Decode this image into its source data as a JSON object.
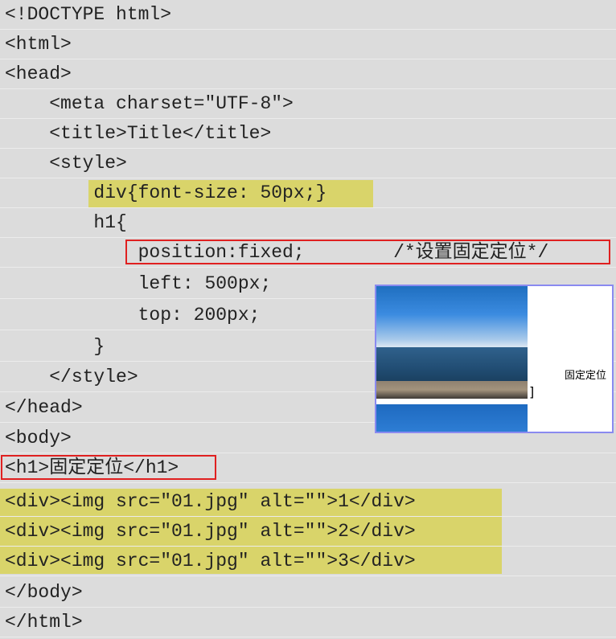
{
  "code_lines": [
    "<!DOCTYPE html>",
    "<html>",
    "<head>",
    "    <meta charset=\"UTF-8\">",
    "    <title>Title</title>",
    "    <style>",
    "        div{font-size: 50px;}",
    "        h1{",
    "            position:fixed;        /*设置固定定位*/",
    "            left: 500px;",
    "            top: 200px;",
    "        }",
    "    </style>",
    "</head>",
    "<body>",
    "<h1>固定定位</h1>",
    "<div><img src=\"01.jpg\" alt=\"\">1</div>",
    "<div><img src=\"01.jpg\" alt=\"\">2</div>",
    "<div><img src=\"01.jpg\" alt=\"\">3</div>",
    "</body>",
    "</html>"
  ],
  "preview": {
    "fixed_text": "固定定位",
    "cursor_char": "]"
  },
  "colors": {
    "background": "#dcdcdc",
    "highlight": "#d9d46a",
    "red_box": "#e02020",
    "preview_border": "#8a8af0"
  }
}
